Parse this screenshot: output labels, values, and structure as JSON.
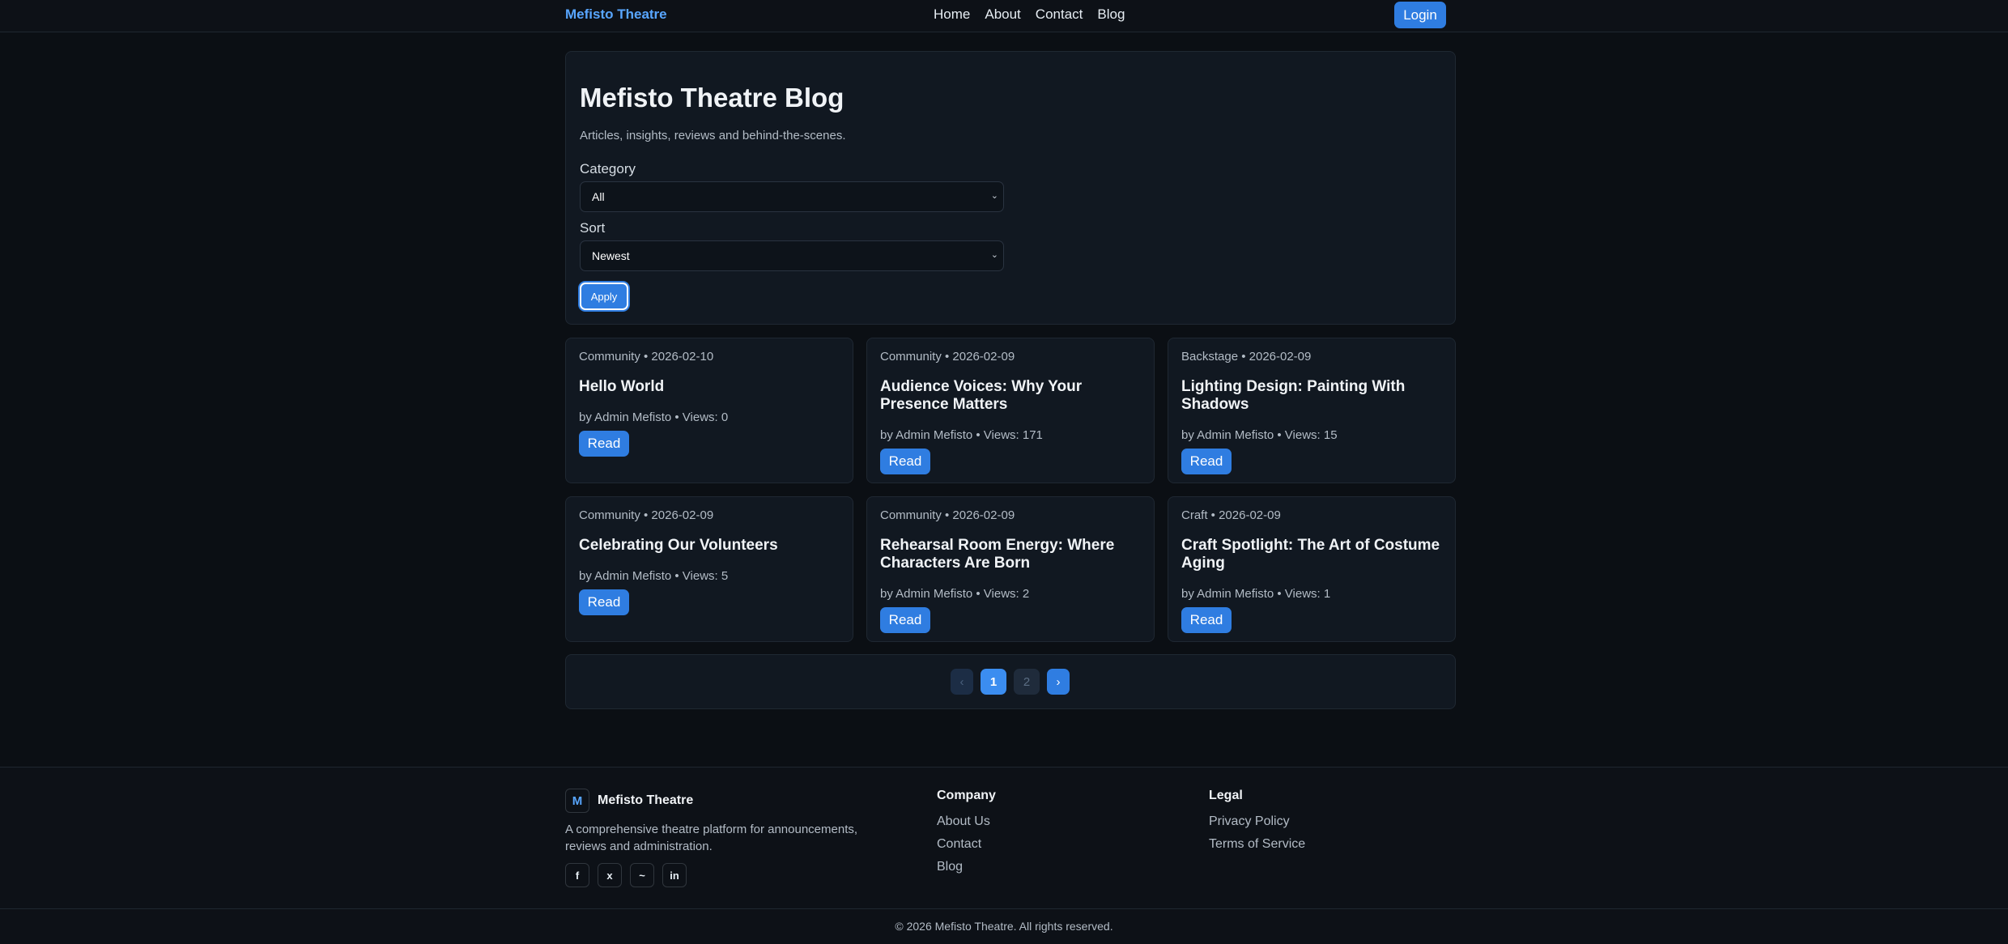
{
  "nav": {
    "brand": "Mefisto Theatre",
    "links": [
      "Home",
      "About",
      "Contact",
      "Blog"
    ],
    "login": "Login"
  },
  "hero": {
    "title": "Mefisto Theatre Blog",
    "subtitle": "Articles, insights, reviews and behind-the-scenes.",
    "category_label": "Category",
    "category_value": "All",
    "sort_label": "Sort",
    "sort_value": "Newest",
    "apply": "Apply"
  },
  "posts": [
    {
      "meta": "Community • 2026-02-10",
      "title": "Hello World",
      "author": "by Admin Mefisto • Views: 0",
      "read": "Read"
    },
    {
      "meta": "Community • 2026-02-09",
      "title": "Audience Voices: Why Your Presence Matters",
      "author": "by Admin Mefisto • Views: 171",
      "read": "Read"
    },
    {
      "meta": "Backstage • 2026-02-09",
      "title": "Lighting Design: Painting With Shadows",
      "author": "by Admin Mefisto • Views: 15",
      "read": "Read"
    },
    {
      "meta": "Community • 2026-02-09",
      "title": "Celebrating Our Volunteers",
      "author": "by Admin Mefisto • Views: 5",
      "read": "Read"
    },
    {
      "meta": "Community • 2026-02-09",
      "title": "Rehearsal Room Energy: Where Characters Are Born",
      "author": "by Admin Mefisto • Views: 2",
      "read": "Read"
    },
    {
      "meta": "Craft • 2026-02-09",
      "title": "Craft Spotlight: The Art of Costume Aging",
      "author": "by Admin Mefisto • Views: 1",
      "read": "Read"
    }
  ],
  "pagination": {
    "prev": "‹",
    "pages": [
      "1",
      "2"
    ],
    "next": "›",
    "current": "1"
  },
  "footer": {
    "logo_letter": "M",
    "brand": "Mefisto Theatre",
    "description": "A comprehensive theatre platform for announcements, reviews and administration.",
    "social": [
      "f",
      "x",
      "~",
      "in"
    ],
    "company_heading": "Company",
    "company_links": [
      "About Us",
      "Contact",
      "Blog"
    ],
    "legal_heading": "Legal",
    "legal_links": [
      "Privacy Policy",
      "Terms of Service"
    ],
    "copyright": "© 2026 Mefisto Theatre. All rights reserved."
  },
  "colors": {
    "accent": "#2f7de1",
    "brand": "#58a6ff",
    "background": "#0b0f14",
    "panel": "#111821"
  }
}
